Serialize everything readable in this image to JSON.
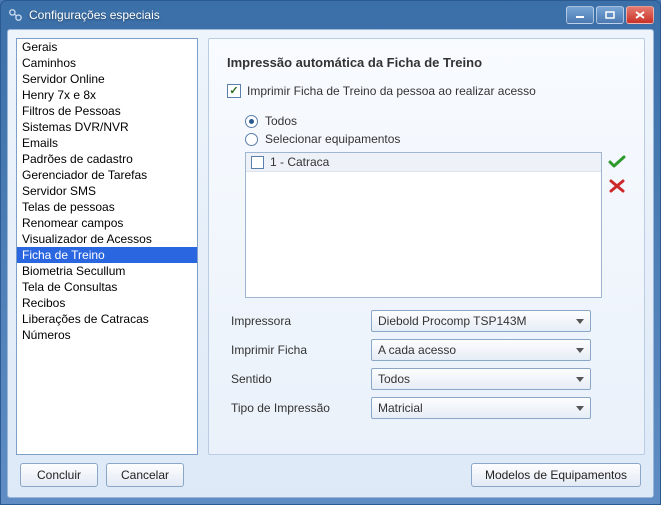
{
  "window": {
    "title": "Configurações especiais"
  },
  "sidebar": {
    "items": [
      {
        "label": "Gerais"
      },
      {
        "label": "Caminhos"
      },
      {
        "label": "Servidor Online"
      },
      {
        "label": "Henry 7x e 8x"
      },
      {
        "label": "Filtros de Pessoas"
      },
      {
        "label": "Sistemas DVR/NVR"
      },
      {
        "label": "Emails"
      },
      {
        "label": "Padrões de cadastro"
      },
      {
        "label": "Gerenciador de Tarefas"
      },
      {
        "label": "Servidor SMS"
      },
      {
        "label": "Telas de pessoas"
      },
      {
        "label": "Renomear campos"
      },
      {
        "label": "Visualizador de Acessos"
      },
      {
        "label": "Ficha de Treino"
      },
      {
        "label": "Biometria Secullum"
      },
      {
        "label": "Tela de Consultas"
      },
      {
        "label": "Recibos"
      },
      {
        "label": "Liberações de Catracas"
      },
      {
        "label": "Números"
      }
    ],
    "selected_index": 13
  },
  "content": {
    "heading": "Impressão automática da Ficha de Treino",
    "print_on_access_label": "Imprimir Ficha de Treino da pessoa ao realizar acesso",
    "print_on_access_checked": true,
    "radios": {
      "all": "Todos",
      "select_equip": "Selecionar equipamentos",
      "selected": "all"
    },
    "equipment": [
      {
        "label": "1 - Catraca",
        "checked": false
      }
    ],
    "fields": {
      "printer": {
        "label": "Impressora",
        "value": "Diebold Procomp TSP143M"
      },
      "print_sheet": {
        "label": "Imprimir Ficha",
        "value": "A cada acesso"
      },
      "direction": {
        "label": "Sentido",
        "value": "Todos"
      },
      "print_type": {
        "label": "Tipo de Impressão",
        "value": "Matricial"
      }
    }
  },
  "buttons": {
    "finish": "Concluir",
    "cancel": "Cancelar",
    "equip_models": "Modelos de Equipamentos"
  }
}
